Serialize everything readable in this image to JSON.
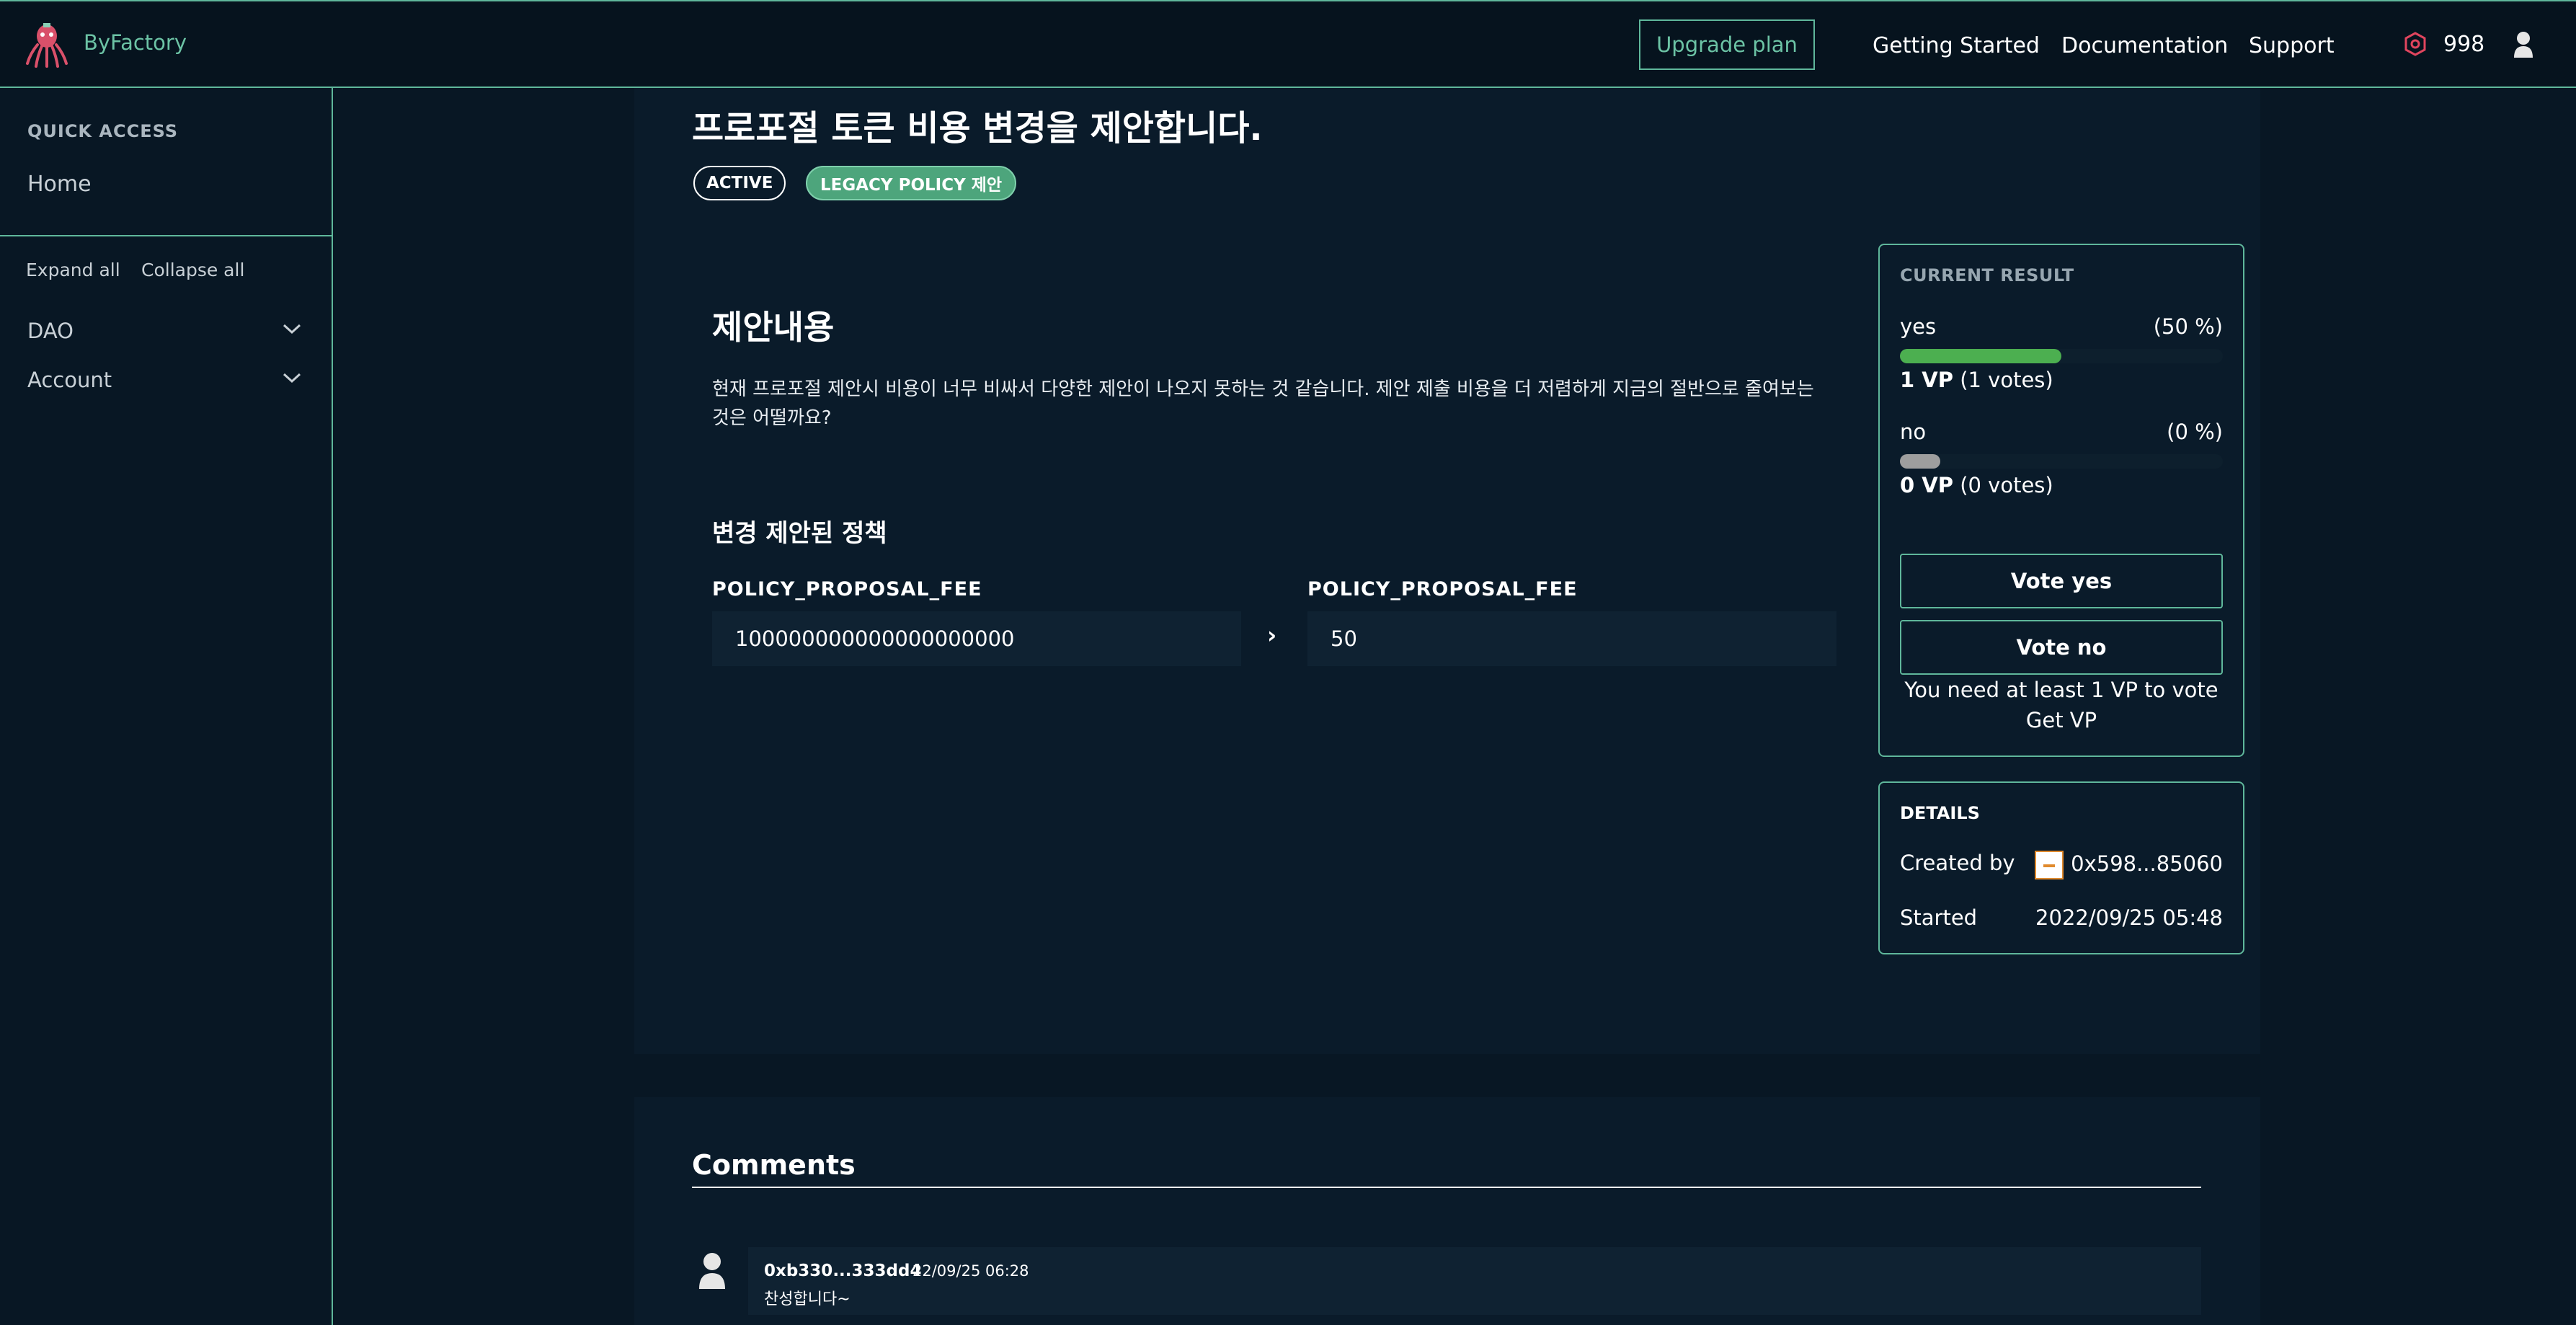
{
  "header": {
    "brand": "ByFactory",
    "upgrade_label": "Upgrade plan",
    "nav": [
      "Getting Started",
      "Documentation",
      "Support"
    ],
    "token_count": "998",
    "accent_color": "#5fb79b"
  },
  "sidebar": {
    "quick_access_title": "QUICK ACCESS",
    "home_label": "Home",
    "expand_all": "Expand all",
    "collapse_all": "Collapse all",
    "items": [
      {
        "label": "DAO"
      },
      {
        "label": "Account"
      }
    ]
  },
  "proposal": {
    "title": "프로포절 토큰 비용 변경을 제안합니다.",
    "status_badge": "ACTIVE",
    "type_badge": "LEGACY POLICY 제안",
    "section_heading": "제안내용",
    "description": "현재 프로포절 제안시 비용이 너무 비싸서 다양한 제안이 나오지 못하는 것 같습니다. 제안 제출 비용을 더 저렴하게 지금의 절반으로 줄여보는 것은 어떨까요?",
    "policy_heading": "변경 제안된 정책",
    "from_label": "POLICY_PROPOSAL_FEE",
    "from_value": "100000000000000000000",
    "arrow": "›",
    "to_label": "POLICY_PROPOSAL_FEE",
    "to_value": "50"
  },
  "result": {
    "title": "CURRENT RESULT",
    "options": [
      {
        "label": "yes",
        "percent": "(50 %)",
        "vp": "1 VP",
        "votes": "(1 votes)",
        "fraction": 0.5,
        "color": "#4caf50"
      },
      {
        "label": "no",
        "percent": "(0 %)",
        "vp": "0 VP",
        "votes": "(0 votes)",
        "fraction": 0.0,
        "color": "#9e9e9e"
      }
    ],
    "vote_yes": "Vote yes",
    "vote_no": "Vote no",
    "note_line1": "You need at least 1 VP to vote",
    "note_line2": "Get VP"
  },
  "details": {
    "title": "DETAILS",
    "created_by_label": "Created by",
    "created_by_value": "0x598...85060",
    "started_label": "Started",
    "started_value": "2022/09/25 05:48"
  },
  "comments": {
    "title": "Comments",
    "items": [
      {
        "author": "0xb330...333dd4",
        "time": "22/09/25 06:28",
        "text": "찬성합니다~"
      }
    ]
  }
}
